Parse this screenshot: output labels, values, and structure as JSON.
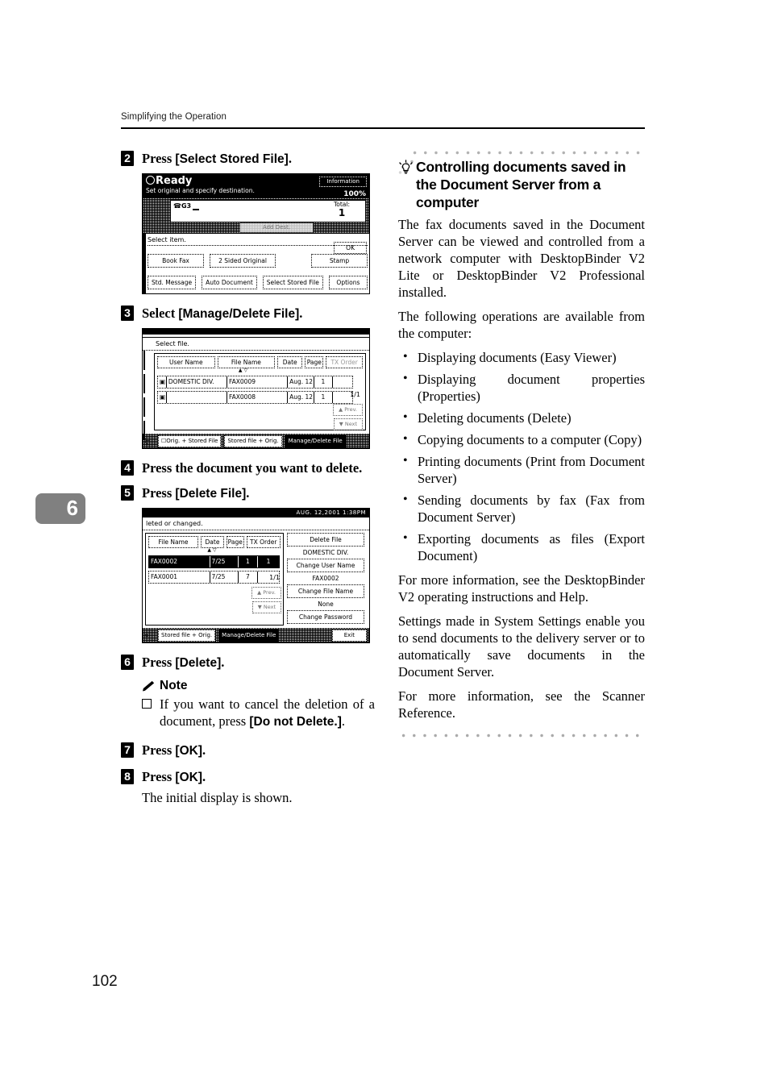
{
  "running_head": "Simplifying the Operation",
  "chapter_tab": "6",
  "folio": "102",
  "steps": {
    "s2": {
      "num": "2",
      "pre": "Press ",
      "ui": "[Select Stored File]",
      "post": "."
    },
    "s3": {
      "num": "3",
      "pre": "Select ",
      "ui": "[Manage/Delete File]",
      "post": "."
    },
    "s4": {
      "num": "4",
      "text": "Press the document you want to delete."
    },
    "s5": {
      "num": "5",
      "pre": "Press ",
      "ui": "[Delete File]",
      "post": "."
    },
    "s6": {
      "num": "6",
      "pre": "Press ",
      "ui": "[Delete]",
      "post": "."
    },
    "s7": {
      "num": "7",
      "pre": "Press ",
      "ui": "[OK]",
      "post": "."
    },
    "s8": {
      "num": "8",
      "pre": "Press ",
      "ui": "[OK]",
      "post": "."
    },
    "s8_body": "The initial display is shown."
  },
  "note": {
    "heading": "Note",
    "icon": "pencil-icon",
    "item_pre": "If you want to cancel the deletion of a document, press ",
    "item_ui": "[Do not Delete.]",
    "item_post": "."
  },
  "lcd1": {
    "status": "Ready",
    "subtitle": "Set original and specify destination.",
    "information_button": "Information",
    "zoom": "100%",
    "line_label": "G3",
    "total_label": "Total:",
    "total_value": "1",
    "add_button": "Add Dest.",
    "select_item": "Select item.",
    "ok_button": "OK",
    "buttons_row1": [
      "Book Fax",
      "2 Sided Original",
      "Stamp"
    ],
    "buttons_row2": [
      "Std. Message",
      "Auto Document",
      "Select Stored File",
      "Options"
    ]
  },
  "lcd2": {
    "heading": "Select file.",
    "columns": [
      "User Name",
      "File Name",
      "Date",
      "Page",
      "TX Order"
    ],
    "rows": [
      {
        "user": "DOMESTIC DIV.",
        "file": "FAX0009",
        "date": "Aug.  12",
        "page": "1",
        "tx": "",
        "selected": false
      },
      {
        "user": "",
        "file": "FAX0008",
        "date": "Aug.  12",
        "page": "1",
        "tx": "",
        "selected": false
      }
    ],
    "pager": "1/1",
    "prev_button": "Prev.",
    "next_button": "Next",
    "footer_buttons": [
      "Orig. + Stored File",
      "Stored file + Orig.",
      "Manage/Delete File"
    ],
    "footer_active": "Manage/Delete File",
    "rail_tabs": [
      "",
      "",
      "",
      ""
    ]
  },
  "lcd3": {
    "status_bar": "AUG. 12,2001  1:38PM",
    "heading": "leted or changed.",
    "columns": [
      "File Name",
      "Date",
      "Page",
      "TX Order"
    ],
    "rows": [
      {
        "file": "FAX0002",
        "date": "7/25",
        "page": "1",
        "tx": "1",
        "selected": true
      },
      {
        "file": "FAX0001",
        "date": "7/25",
        "page": "7",
        "tx": "",
        "selected": false
      }
    ],
    "pager": "1/1",
    "prev_button": "Prev.",
    "next_button": "Next",
    "delete_file_button": "Delete File",
    "user_name_value": "DOMESTIC DIV.",
    "change_user_name_button": "Change User Name",
    "file_name_value": "FAX0002",
    "change_file_name_button": "Change File Name",
    "password_value": "None",
    "change_password_button": "Change Password",
    "footer_buttons": [
      "Stored file + Orig.",
      "Manage/Delete File"
    ],
    "footer_active": "Manage/Delete File",
    "exit_button": "Exit"
  },
  "tip": {
    "icon": "lightbulb-icon",
    "title": "Controlling documents saved in the Document Server from a computer",
    "p1": "The fax documents saved in the Document Server can be viewed and controlled from a network computer with DesktopBinder V2 Lite or DesktopBinder V2 Professional installed.",
    "p2": "The following operations are available from the computer:",
    "bullets": [
      "Displaying documents (Easy Viewer)",
      "Displaying document properties (Properties)",
      "Deleting documents (Delete)",
      "Copying documents to a computer (Copy)",
      "Printing documents (Print from Document Server)",
      "Sending documents by fax (Fax from Document Server)",
      "Exporting documents as files (Export Document)"
    ],
    "p3": "For more information, see the DesktopBinder V2 operating instructions and Help.",
    "p4": "Settings made in System Settings enable you to send documents to the delivery server or to automatically save documents in the Document Server.",
    "p5": "For more information, see the Scanner Reference."
  }
}
